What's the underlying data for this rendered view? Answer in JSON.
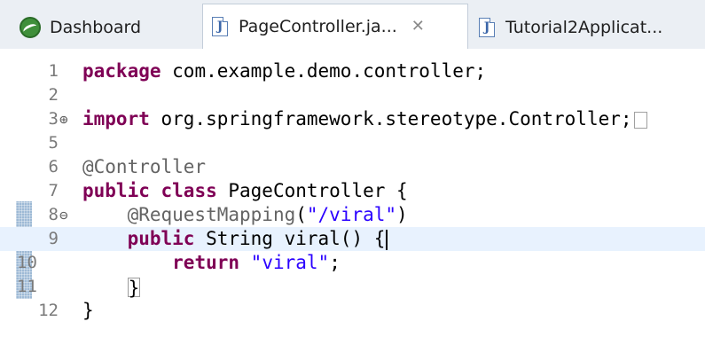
{
  "tabs": [
    {
      "label": "Dashboard",
      "icon": "dashboard-icon",
      "active": false
    },
    {
      "label": "PageController.ja...",
      "icon": "java-file-icon",
      "active": true,
      "close_glyph": "✕"
    },
    {
      "label": "Tutorial2Applicat...",
      "icon": "java-file-icon",
      "active": false
    }
  ],
  "editor": {
    "current_line": 9,
    "lines": [
      {
        "num": "1",
        "parts": [
          [
            "kw",
            "package"
          ],
          [
            "plain",
            " com.example.demo.controller;"
          ]
        ]
      },
      {
        "num": "2",
        "parts": []
      },
      {
        "num": "3",
        "fold": "⊕",
        "parts": [
          [
            "kw",
            "import"
          ],
          [
            "plain",
            " org.springframework.stereotype.Controller;"
          ]
        ],
        "folded_box": true
      },
      {
        "num": "5",
        "parts": []
      },
      {
        "num": "6",
        "parts": [
          [
            "ann",
            "@Controller"
          ]
        ]
      },
      {
        "num": "7",
        "parts": [
          [
            "kw",
            "public"
          ],
          [
            "plain",
            " "
          ],
          [
            "kw",
            "class"
          ],
          [
            "plain",
            " PageController {"
          ]
        ]
      },
      {
        "num": "8",
        "fold": "⊖",
        "parts": [
          [
            "plain",
            "    "
          ],
          [
            "ann",
            "@RequestMapping"
          ],
          [
            "plain",
            "("
          ],
          [
            "str",
            "\"/viral\""
          ],
          [
            "plain",
            ")"
          ]
        ]
      },
      {
        "num": "9",
        "parts": [
          [
            "plain",
            "    "
          ],
          [
            "kw",
            "public"
          ],
          [
            "plain",
            " String viral() {"
          ]
        ],
        "caret": true
      },
      {
        "num": "10",
        "parts": [
          [
            "plain",
            "        "
          ],
          [
            "kw",
            "return"
          ],
          [
            "plain",
            " "
          ],
          [
            "str",
            "\"viral\""
          ],
          [
            "plain",
            ";"
          ]
        ]
      },
      {
        "num": "11",
        "parts": [
          [
            "plain",
            "    "
          ]
        ],
        "boxed_brace": "}"
      },
      {
        "num": "12",
        "parts": [
          [
            "plain",
            "}"
          ]
        ]
      }
    ]
  },
  "colors": {
    "keyword": "#7f0055",
    "annotation": "#646464",
    "string": "#2a00ff",
    "current_line_bg": "#e8f2fe",
    "change_marker": "#9ebad6"
  }
}
